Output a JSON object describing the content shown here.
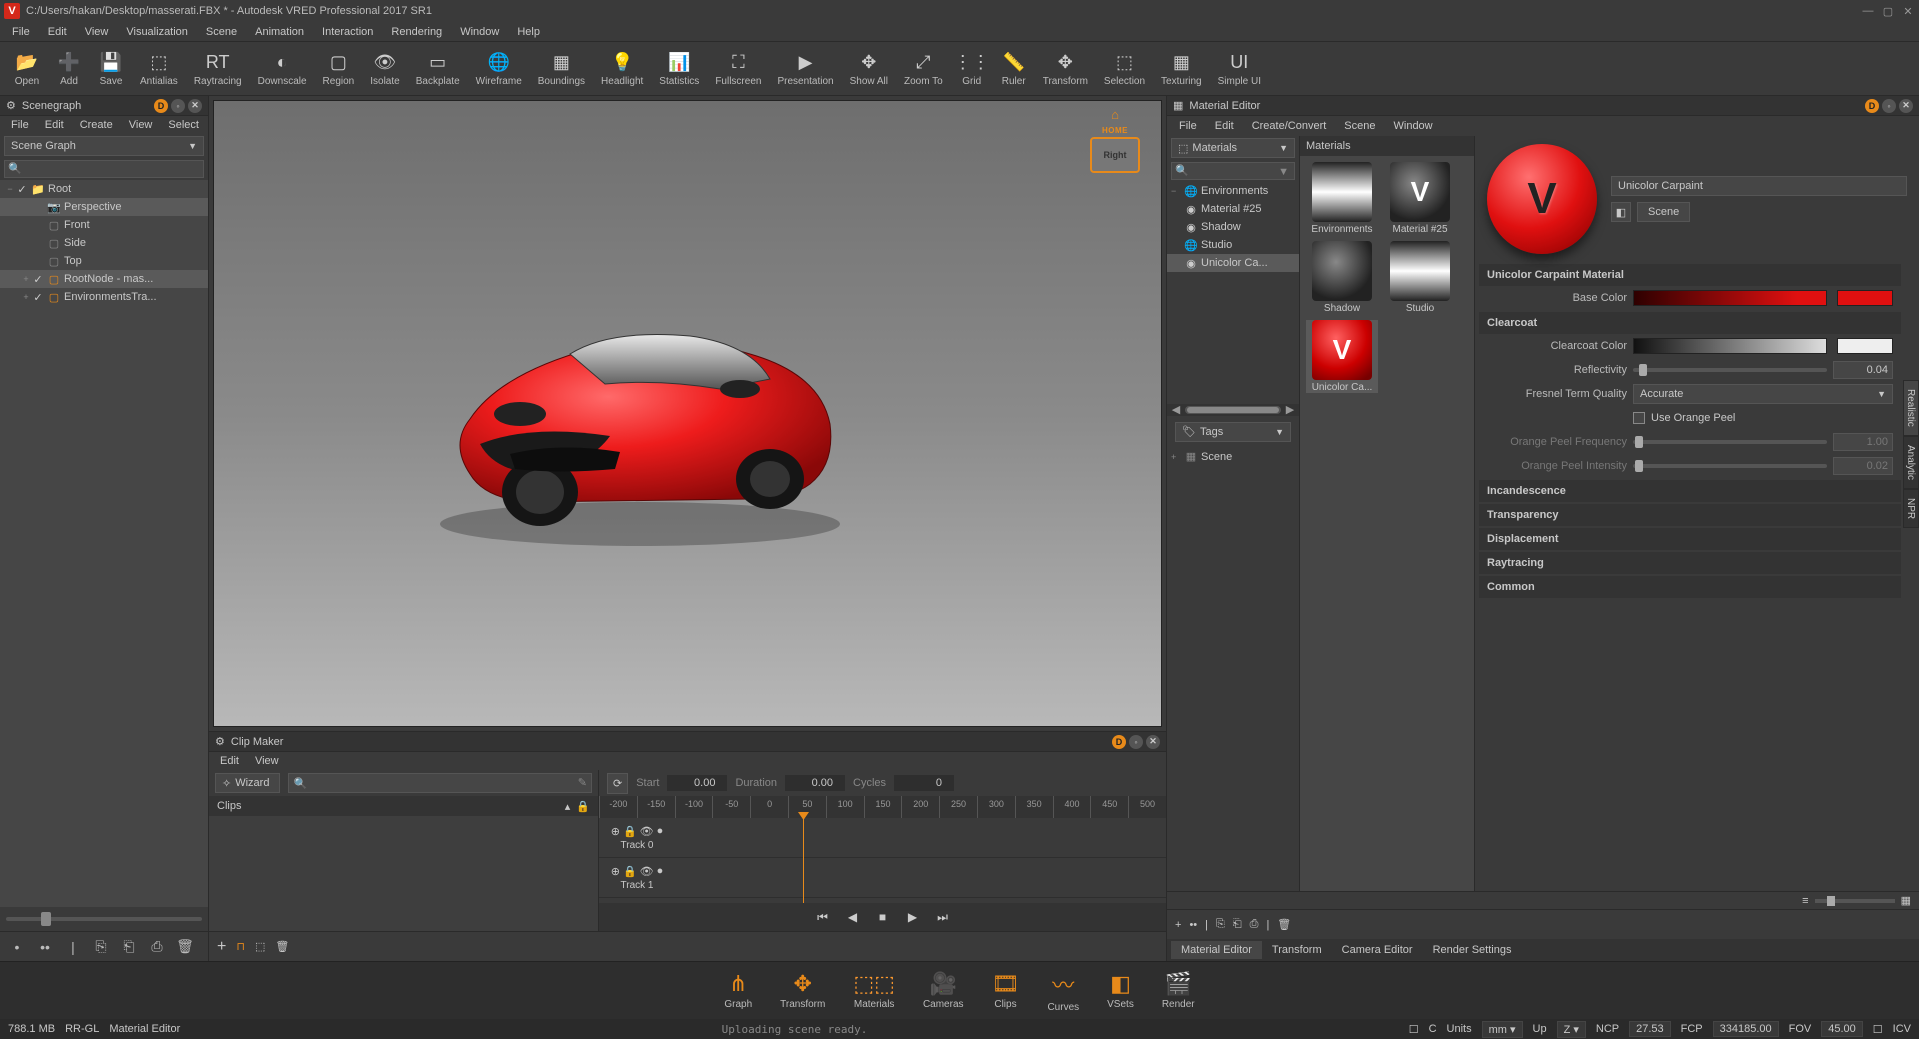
{
  "window": {
    "title": "C:/Users/hakan/Desktop/masserati.FBX * - Autodesk VRED Professional 2017 SR1",
    "logo": "V"
  },
  "main_menu": [
    "File",
    "Edit",
    "View",
    "Visualization",
    "Scene",
    "Animation",
    "Interaction",
    "Rendering",
    "Window",
    "Help"
  ],
  "toolbar": [
    {
      "label": "Open",
      "icon": "📂"
    },
    {
      "label": "Add",
      "icon": "➕"
    },
    {
      "label": "Save",
      "icon": "💾"
    },
    {
      "label": "Antialias",
      "icon": "⬚"
    },
    {
      "label": "Raytracing",
      "icon": "RT"
    },
    {
      "label": "Downscale",
      "icon": "◐"
    },
    {
      "label": "Region",
      "icon": "▢"
    },
    {
      "label": "Isolate",
      "icon": "👁"
    },
    {
      "label": "Backplate",
      "icon": "▭"
    },
    {
      "label": "Wireframe",
      "icon": "🌐"
    },
    {
      "label": "Boundings",
      "icon": "▦"
    },
    {
      "label": "Headlight",
      "icon": "💡"
    },
    {
      "label": "Statistics",
      "icon": "📊"
    },
    {
      "label": "Fullscreen",
      "icon": "⛶"
    },
    {
      "label": "Presentation",
      "icon": "▶"
    },
    {
      "label": "Show All",
      "icon": "✥"
    },
    {
      "label": "Zoom To",
      "icon": "⤢"
    },
    {
      "label": "Grid",
      "icon": "⋮⋮"
    },
    {
      "label": "Ruler",
      "icon": "📏"
    },
    {
      "label": "Transform",
      "icon": "✥"
    },
    {
      "label": "Selection",
      "icon": "⬚"
    },
    {
      "label": "Texturing",
      "icon": "▦"
    },
    {
      "label": "Simple UI",
      "icon": "UI"
    }
  ],
  "scenegraph": {
    "title": "Scenegraph",
    "menu": [
      "File",
      "Edit",
      "Create",
      "View",
      "Select"
    ],
    "dropdown": "Scene Graph",
    "tree": [
      {
        "indent": 0,
        "exp": "−",
        "chk": "✓",
        "icon": "folder",
        "label": "Root"
      },
      {
        "indent": 1,
        "exp": "",
        "chk": "",
        "icon": "cam",
        "label": "Perspective",
        "sel": true
      },
      {
        "indent": 1,
        "exp": "",
        "chk": "",
        "icon": "node",
        "label": "Front"
      },
      {
        "indent": 1,
        "exp": "",
        "chk": "",
        "icon": "node",
        "label": "Side"
      },
      {
        "indent": 1,
        "exp": "",
        "chk": "",
        "icon": "node",
        "label": "Top"
      },
      {
        "indent": 1,
        "exp": "+",
        "chk": "✓",
        "icon": "orange-node",
        "label": "RootNode - mas...",
        "sel": true
      },
      {
        "indent": 1,
        "exp": "+",
        "chk": "✓",
        "icon": "orange-node",
        "label": "EnvironmentsTra..."
      }
    ]
  },
  "viewport": {
    "nav_home": "HOME",
    "nav_face": "Right"
  },
  "clip": {
    "title": "Clip Maker",
    "menu": [
      "Edit",
      "View"
    ],
    "wizard": "Wizard",
    "clips_hdr": "Clips",
    "start_lbl": "Start",
    "start_val": "0.00",
    "dur_lbl": "Duration",
    "dur_val": "0.00",
    "cycles_lbl": "Cycles",
    "cycles_val": "0",
    "ruler": [
      "-200",
      "-150",
      "-100",
      "-50",
      "0",
      "50",
      "100",
      "150",
      "200",
      "250",
      "300",
      "350",
      "400",
      "450",
      "500"
    ],
    "tracks": [
      "Track 0",
      "Track 1"
    ]
  },
  "material_editor": {
    "title": "Material Editor",
    "menu": [
      "File",
      "Edit",
      "Create/Convert",
      "Scene",
      "Window"
    ],
    "materials_dd": "Materials",
    "mat_tree": [
      {
        "exp": "−",
        "icon": "blue",
        "label": "Environments"
      },
      {
        "exp": "",
        "icon": "vball",
        "label": "Material #25"
      },
      {
        "exp": "",
        "icon": "vball",
        "label": "Shadow"
      },
      {
        "exp": "",
        "icon": "blue",
        "label": "Studio"
      },
      {
        "exp": "",
        "icon": "vball",
        "label": "Unicolor Ca...",
        "sel": true
      }
    ],
    "tags_dd": "Tags",
    "scene_tree": [
      {
        "exp": "+",
        "label": "Scene"
      }
    ],
    "thumbs_hdr": "Materials",
    "thumbs": [
      {
        "label": "Environments",
        "type": "env"
      },
      {
        "label": "Material #25",
        "type": "vlogo"
      },
      {
        "label": "Shadow",
        "type": "dark"
      },
      {
        "label": "Studio",
        "type": "env"
      },
      {
        "label": "Unicolor Ca...",
        "type": "red",
        "sel": true
      }
    ],
    "preview_name": "Unicolor Carpaint",
    "scene_btn": "Scene",
    "section_title": "Unicolor Carpaint Material",
    "base_color_lbl": "Base Color",
    "clearcoat_hdr": "Clearcoat",
    "cc_color_lbl": "Clearcoat Color",
    "reflect_lbl": "Reflectivity",
    "reflect_val": "0.04",
    "fresnel_lbl": "Fresnel Term Quality",
    "fresnel_val": "Accurate",
    "orange_peel_chk": "Use Orange Peel",
    "op_freq_lbl": "Orange Peel Frequency",
    "op_freq_val": "1.00",
    "op_int_lbl": "Orange Peel Intensity",
    "op_int_val": "0.02",
    "sections": [
      "Incandescence",
      "Transparency",
      "Displacement",
      "Raytracing",
      "Common"
    ],
    "vert_tabs": [
      "Realistic",
      "Analytic",
      "NPR"
    ]
  },
  "right_tabs": [
    "Material Editor",
    "Transform",
    "Camera Editor",
    "Render Settings"
  ],
  "bottom_strip": [
    {
      "label": "Graph",
      "icon": "⋔"
    },
    {
      "label": "Transform",
      "icon": "✥"
    },
    {
      "label": "Materials",
      "icon": "⬚⬚",
      "active": true
    },
    {
      "label": "Cameras",
      "icon": "🎥"
    },
    {
      "label": "Clips",
      "icon": "🎞"
    },
    {
      "label": "Curves",
      "icon": "〰"
    },
    {
      "label": "VSets",
      "icon": "◧"
    },
    {
      "label": "Render",
      "icon": "🎬"
    }
  ],
  "status": {
    "mem": "788.1 MB",
    "mode": "RR-GL",
    "panel": "Material Editor",
    "msg": "Uploading scene ready.",
    "c_lbl": "C",
    "units_lbl": "Units",
    "units_val": "mm",
    "up_lbl": "Up",
    "up_val": "Z",
    "ncp_lbl": "NCP",
    "ncp_val": "27.53",
    "fcp_lbl": "FCP",
    "fcp_val": "334185.00",
    "fov_lbl": "FOV",
    "fov_val": "45.00",
    "icv_lbl": "ICV"
  }
}
